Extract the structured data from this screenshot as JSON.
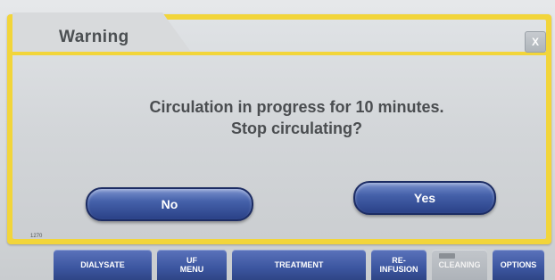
{
  "dialog": {
    "title": "Warning",
    "close_label": "X",
    "message_line1": "Circulation in progress for 10 minutes.",
    "message_line2": "Stop circulating?",
    "no_label": "No",
    "yes_label": "Yes",
    "code": "1270"
  },
  "tabs": [
    {
      "label": "DIALYSATE"
    },
    {
      "label": "UF\nMENU"
    },
    {
      "label": "TREATMENT"
    },
    {
      "label": "RE-\nINFUSION"
    },
    {
      "label": "CLEANING"
    },
    {
      "label": "OPTIONS"
    }
  ],
  "colors": {
    "frame": "#f2d53a",
    "button_blue": "#3c56a0",
    "text_dark": "#4a4d50"
  }
}
